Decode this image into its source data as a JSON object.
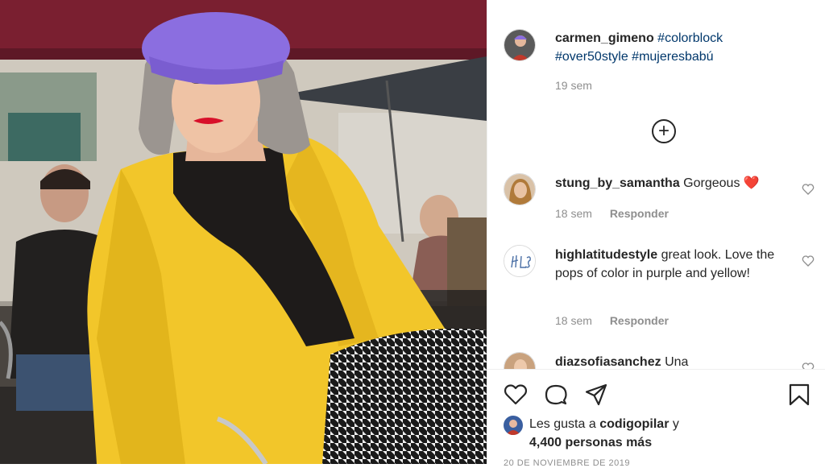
{
  "post": {
    "author": "carmen_gimeno",
    "caption_tags": [
      "#colorblock",
      "#over50style",
      "#mujeresbabú"
    ],
    "time_ago": "19 sem",
    "load_more_label": "+"
  },
  "comments": [
    {
      "user": "stung_by_samantha",
      "text": "Gorgeous ❤️",
      "time": "18 sem",
      "reply": "Responder"
    },
    {
      "user": "highlatitudestyle",
      "text": "great look. Love the pops of color in purple and yellow!",
      "time": "18 sem",
      "reply": "Responder"
    },
    {
      "user": "diazsofiasanchez",
      "text": "Una"
    }
  ],
  "likes": {
    "prefix": "Les gusta a",
    "user": "codigopilar",
    "conjunction": "y",
    "count_text": "4,400 personas más"
  },
  "date": "20 DE NOVIEMBRE DE 2019",
  "icons": {
    "like": "heart-icon",
    "comment": "comment-icon",
    "share": "share-icon",
    "save": "bookmark-icon",
    "add": "plus-circle-icon"
  },
  "colors": {
    "text": "#262626",
    "secondary": "#8e8e8e",
    "hashtag": "#00376b",
    "heart_red": "#ed4956"
  }
}
